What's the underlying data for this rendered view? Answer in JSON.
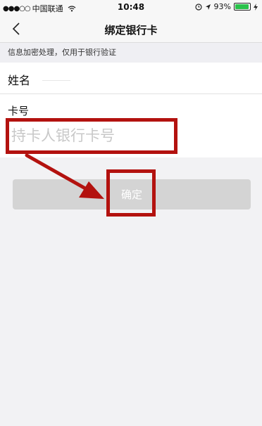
{
  "status_bar": {
    "signal": "●●●○○",
    "carrier": "中国联通",
    "time": "10:48",
    "battery_percent": "93%",
    "battery_level": 0.93
  },
  "nav": {
    "title": "绑定银行卡",
    "back_icon": "chevron-left-icon"
  },
  "notice": "信息加密处理，仅用于银行验证",
  "form": {
    "name_label": "姓名",
    "name_value": "",
    "card_label": "卡号",
    "card_placeholder": "持卡人银行卡号",
    "card_value": ""
  },
  "confirm_label": "确定",
  "colors": {
    "highlight": "#b3120f",
    "button_disabled": "#d4d4d4",
    "battery": "#29c24a"
  }
}
